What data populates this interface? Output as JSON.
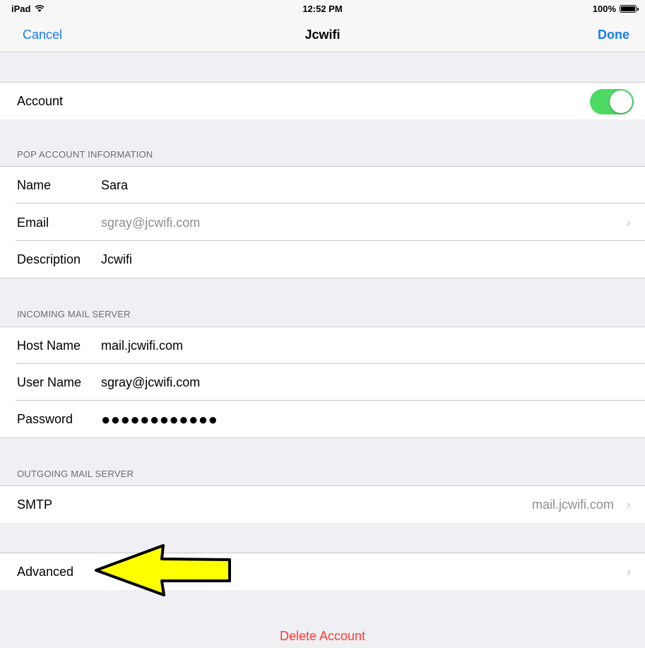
{
  "status_bar": {
    "device": "iPad",
    "time": "12:52 PM",
    "battery": "100%",
    "wifi_icon": "wifi-icon",
    "battery_icon": "battery-icon"
  },
  "nav": {
    "cancel": "Cancel",
    "title": "Jcwifi",
    "done": "Done"
  },
  "account": {
    "label": "Account",
    "enabled": true,
    "toggle_color": "#4cd964"
  },
  "pop_section": {
    "header": "POP ACCOUNT INFORMATION",
    "name_label": "Name",
    "name_value": "Sara",
    "email_label": "Email",
    "email_value": "sgray@jcwifi.com",
    "description_label": "Description",
    "description_value": "Jcwifi"
  },
  "incoming_section": {
    "header": "INCOMING MAIL SERVER",
    "host_label": "Host Name",
    "host_value": "mail.jcwifi.com",
    "user_label": "User Name",
    "user_value": "sgray@jcwifi.com",
    "password_label": "Password",
    "password_value": "●●●●●●●●●●●●"
  },
  "outgoing_section": {
    "header": "OUTGOING MAIL SERVER",
    "smtp_label": "SMTP",
    "smtp_value": "mail.jcwifi.com"
  },
  "advanced": {
    "label": "Advanced"
  },
  "delete": {
    "label": "Delete Account",
    "color": "#ff3b30"
  },
  "annotation": {
    "arrow_color": "#ffff00",
    "arrow_icon": "left-arrow-icon"
  },
  "colors": {
    "accent": "#147efb",
    "background": "#efeff4"
  }
}
